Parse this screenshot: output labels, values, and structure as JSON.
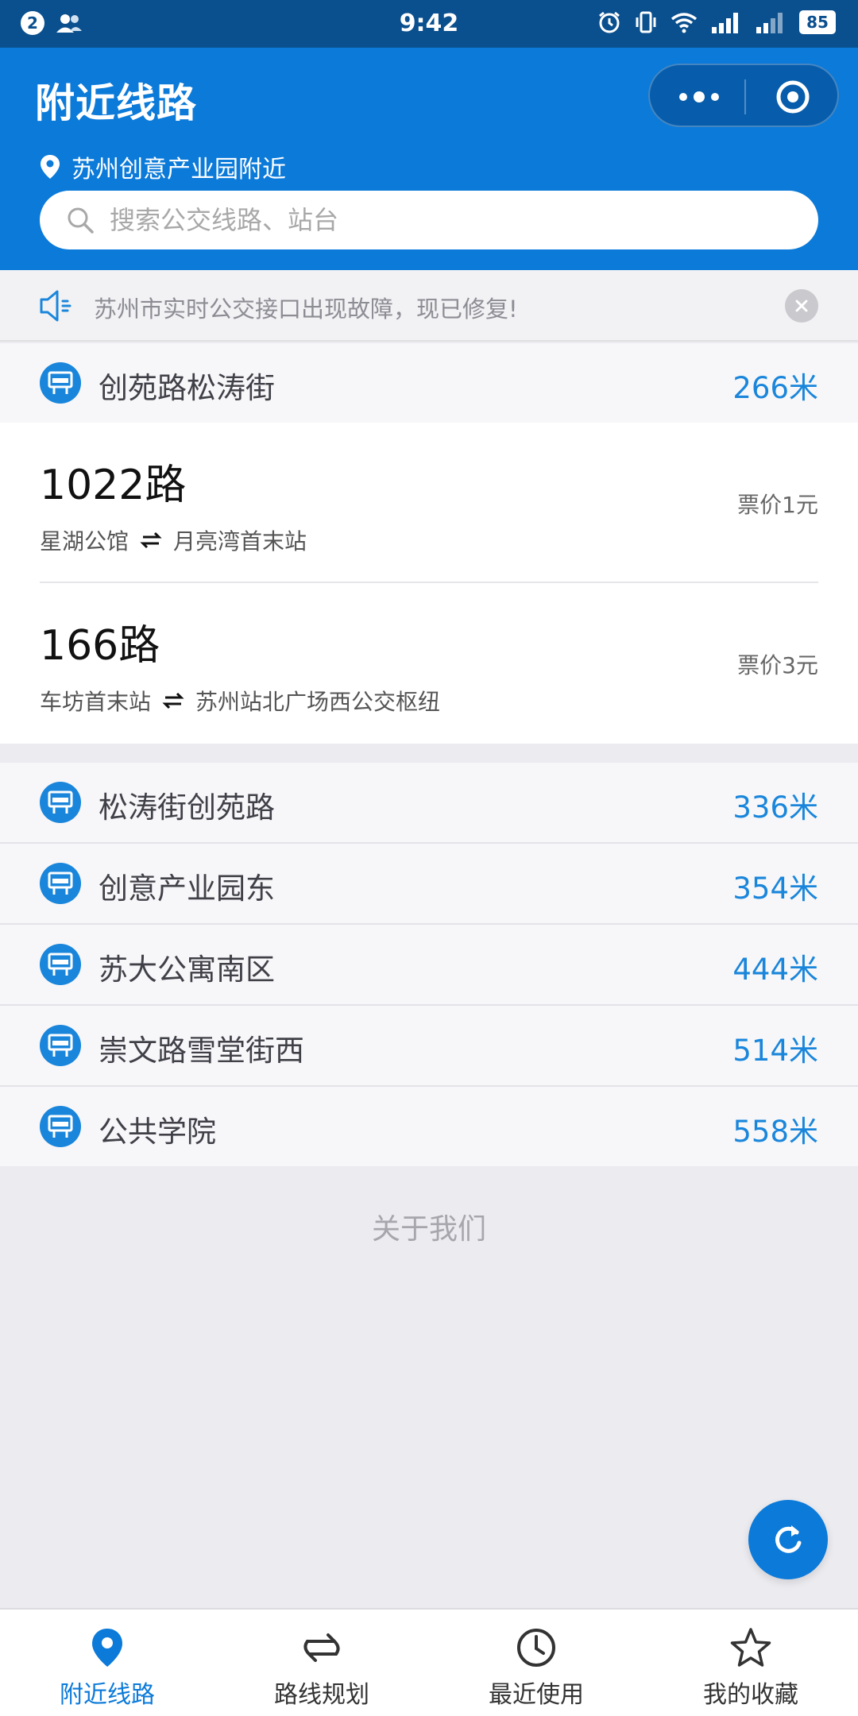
{
  "status_bar": {
    "notification_count": "2",
    "time": "9:42",
    "battery": "85",
    "icons": [
      "contacts-icon",
      "alarm-icon",
      "vibrate-icon",
      "wifi-icon",
      "signal-icon",
      "signal-icon-2",
      "battery-icon"
    ]
  },
  "header": {
    "title": "附近线路",
    "location": "苏州创意产业园附近",
    "search_placeholder": "搜索公交线路、站台"
  },
  "notice": {
    "text": "苏州市实时公交接口出现故障，现已修复!"
  },
  "first_station": {
    "name": "创苑路松涛街",
    "distance": "266米"
  },
  "routes": [
    {
      "name": "1022路",
      "from": "星湖公馆",
      "to": "月亮湾首末站",
      "fare": "票价1元"
    },
    {
      "name": "166路",
      "from": "车坊首末站",
      "to": "苏州站北广场西公交枢纽",
      "fare": "票价3元"
    }
  ],
  "stations": [
    {
      "name": "松涛街创苑路",
      "distance": "336米"
    },
    {
      "name": "创意产业园东",
      "distance": "354米"
    },
    {
      "name": "苏大公寓南区",
      "distance": "444米"
    },
    {
      "name": "崇文路雪堂街西",
      "distance": "514米"
    },
    {
      "name": "公共学院",
      "distance": "558米"
    }
  ],
  "footer": {
    "about": "关于我们"
  },
  "tabbar": {
    "items": [
      {
        "label": "附近线路",
        "icon": "location-pin-icon",
        "active": true
      },
      {
        "label": "路线规划",
        "icon": "route-swap-icon",
        "active": false
      },
      {
        "label": "最近使用",
        "icon": "clock-icon",
        "active": false
      },
      {
        "label": "我的收藏",
        "icon": "star-icon",
        "active": false
      }
    ]
  },
  "colors": {
    "status_bar": "#0a4f8e",
    "primary": "#0b7ad9",
    "distance": "#1a86db",
    "background": "#ebebf0"
  }
}
